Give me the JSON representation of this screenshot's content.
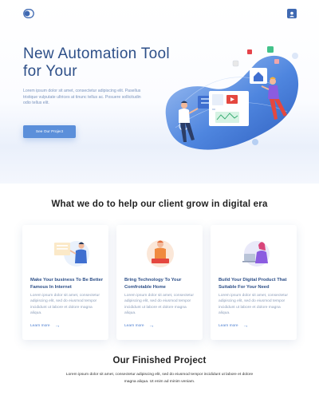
{
  "header": {
    "logo_icon": "toggle-logo-icon",
    "profile_icon": "profile-icon"
  },
  "hero": {
    "title": "New Automation Tool for Your",
    "description": "Lorem ipsum dolor sit amet, consectetur adipiscing elit. Pasellus tristique vulputate ultrices at tinunc tellus ac. Posuere sollicitudin odio tellus elit.",
    "cta_label": "See Our Project"
  },
  "services": {
    "heading": "What we do to help our client grow in digital era",
    "cards": [
      {
        "title": "Make Your business To Be Better Famous In Internet",
        "body": "Lorem ipsum dolor sit amet, consectetur adipiscing elit, sed do eiusmod tempor incididunt ut labore et dolore magna aliqua.",
        "link": "Learn more"
      },
      {
        "title": "Bring Technology To Your Comfrotable Home",
        "body": "Lorem ipsum dolor sit amet, consectetur adipiscing elit, sed do eiusmod tempor incididunt ut labore et dolore magna aliqua.",
        "link": "Learn more"
      },
      {
        "title": "Build Your Digital Product That Suitable For Your Need",
        "body": "Lorem ipsum dolor sit amet, consectetur adipiscing elit, sed do eiusmod tempor incididunt ut labore et dolore magna aliqua.",
        "link": "Learn more"
      }
    ]
  },
  "projects": {
    "heading": "Our Finished Project",
    "description": "Lorem ipsum dolor sit amet, consectetur adipiscing elit, sed do eiusmod tempor incididunt ut labore et dolore magna aliqua. Ut enim ad minim veniam."
  },
  "colors": {
    "primary": "#2d4f88",
    "accent": "#5b8fda",
    "link": "#4d7fd1",
    "muted": "#8a9cb8"
  }
}
